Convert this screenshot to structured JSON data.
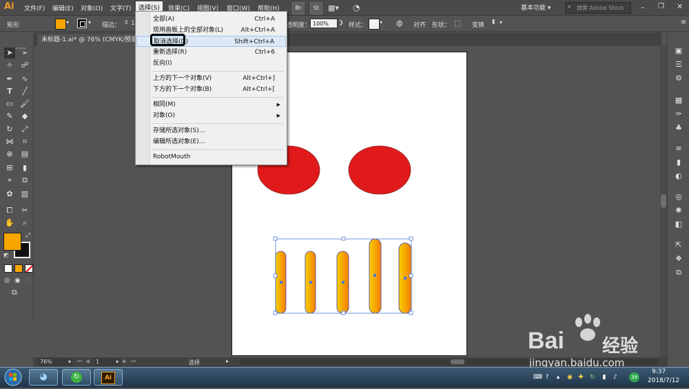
{
  "app": {
    "logo": "Ai"
  },
  "menubar": {
    "items": [
      "文件(F)",
      "编辑(E)",
      "对象(O)",
      "文字(T)",
      "选择(S)",
      "效果(C)",
      "视图(V)",
      "窗口(W)",
      "帮助(H)"
    ],
    "bridge_label": "Br",
    "stock_label": "St",
    "workspace": "基本功能",
    "search_placeholder": "搜索 Adobe Stock"
  },
  "controlbar": {
    "tool_name": "矩形",
    "stroke_label": "描边：",
    "stroke_value": "1",
    "opacity_label": "透明度：",
    "opacity_value": "100%",
    "style_label": "样式：",
    "align_label": "对齐",
    "shape_label": "形状：",
    "transform_label": "变换"
  },
  "document": {
    "tab_title": "未标题-1.ai* @ 76% (CMYK/预览)"
  },
  "select_menu": {
    "items": [
      {
        "label": "全部(A)",
        "shortcut": "Ctrl+A"
      },
      {
        "label": "现用画板上的全部对象(L)",
        "shortcut": "Alt+Ctrl+A"
      },
      {
        "label": "取消选择(D)",
        "shortcut": "Shift+Ctrl+A"
      },
      {
        "label": "重新选择(R)",
        "shortcut": "Ctrl+6"
      },
      {
        "label": "反向(I)",
        "shortcut": ""
      },
      {
        "label": "上方的下一个对象(V)",
        "shortcut": "Alt+Ctrl+]"
      },
      {
        "label": "下方的下一个对象(B)",
        "shortcut": "Alt+Ctrl+["
      },
      {
        "label": "相同(M)",
        "shortcut": ""
      },
      {
        "label": "对象(O)",
        "shortcut": ""
      },
      {
        "label": "存储所选对象(S)...",
        "shortcut": ""
      },
      {
        "label": "编辑所选对象(E)...",
        "shortcut": ""
      },
      {
        "label": "RobotMouth",
        "shortcut": ""
      }
    ],
    "highlighted_index": 2
  },
  "statusbar": {
    "zoom": "76%",
    "artboard_number": "1",
    "tool_status": "选择"
  },
  "taskbar": {
    "ai_label": "Ai",
    "badge_count": "39",
    "time": "9:37",
    "date": "2018/7/12"
  },
  "watermark": {
    "brand": "Bai",
    "brand_suffix": "经验",
    "url": "jingyan.baidu.com"
  },
  "colors": {
    "fill_swatch": "#f7a600",
    "eye_red": "#e01a1a",
    "bar_gradient_start": "#f7d000",
    "bar_gradient_end": "#f57c00",
    "selection_blue": "#4a7bd6"
  }
}
